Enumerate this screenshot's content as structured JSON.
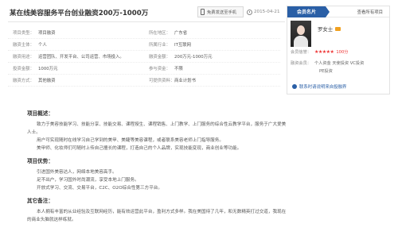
{
  "header": {
    "title": "某在线美容服务平台创业融资200万-1000万",
    "send_phone": "免费发送至手机",
    "date": "2015-04-21"
  },
  "info": [
    [
      {
        "k": "项目类型：",
        "v": "项目融资"
      },
      {
        "k": "所在地区：",
        "v": "广东省"
      }
    ],
    [
      {
        "k": "融资主体：",
        "v": "个人"
      },
      {
        "k": "所属行业：",
        "v": "IT互联网"
      }
    ],
    [
      {
        "k": "融资用途：",
        "v": "运营团队、开发平台、公司运营、市场投入。"
      },
      {
        "k": "融资金额：",
        "v": "200万元-1000万元"
      }
    ],
    [
      {
        "k": "投资金额：",
        "v": "1000万元"
      },
      {
        "k": "参与资金：",
        "v": "不限"
      }
    ],
    [
      {
        "k": "融资方式：",
        "v": "其他融资"
      },
      {
        "k": "可提供资料：",
        "v": "商业计划书"
      }
    ]
  ],
  "content": {
    "h1": "项目概述：",
    "p1a": "致力于美容技能学习、技能分享、技能交易、课程授生、课程销售、上门教学、上门服务的综合性云教学平台，服务于广大爱美人士。",
    "p1b": "用户可实现随时在线学习自己学到的美甲、美睫等美容课程，或者联系美容老师上门指导服务。",
    "p1c": "美甲师、化妆师们可随时上传自己擅长的课程，打造自己的个人品牌，实现技能变现，商业创业等功能。",
    "h2": "项目优势：",
    "p2a": "引进国外美容达人，网络本地美容高手。",
    "p2b": "足不出户，学习国外时尚潮流，享受本地上门服务。",
    "p2c": "开放式学习、交流、交易平台，C2C、O2O综合性第三方平台。",
    "h3": "其它备注：",
    "p3a": "本人拥有丰富的从业经验及互联网经历，能有效运营此平台，盈利方式多样。我在美国待了几年，和无数精英打过交道，我现在的商业头脑就这样练就。"
  },
  "panel": {
    "tag": "会员名片",
    "link": "查看所有项目",
    "name": "罗女士",
    "credit_key": "会员信誉：",
    "stars": "★★★★★",
    "score": "100分",
    "identity_key": "融资会员：",
    "identity": "个人资金 天使投资 VC投资",
    "identity2": "PE投资",
    "contact": "联系时请说明来自投融界"
  }
}
